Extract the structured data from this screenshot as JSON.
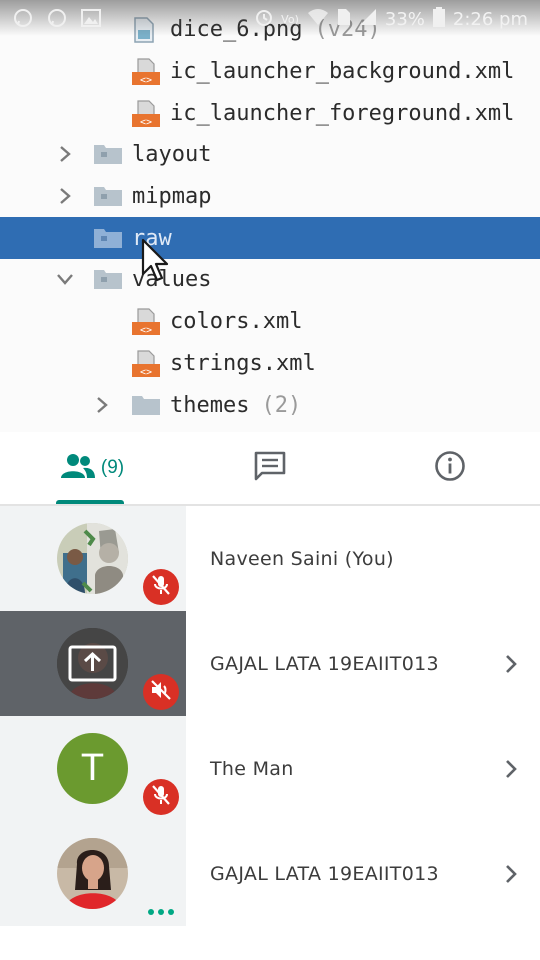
{
  "status_bar": {
    "battery": "33%",
    "time": "2:26 pm",
    "left_icons": [
      "whatsapp-icon",
      "whatsapp-icon",
      "image-icon"
    ],
    "right_icons": [
      "alarm-icon",
      "volte-icon",
      "wifi-icon",
      "sim-icon",
      "signal-icon",
      "battery-icon"
    ]
  },
  "project_tree": {
    "items": [
      {
        "label": "dice_6.png",
        "count": "(v24)",
        "icon": "image-file-icon"
      },
      {
        "label": "ic_launcher_background.xml",
        "icon": "xml-file-icon"
      },
      {
        "label": "ic_launcher_foreground.xml",
        "icon": "xml-file-icon"
      },
      {
        "label": "layout",
        "icon": "folder-icon",
        "chevron": "right"
      },
      {
        "label": "mipmap",
        "icon": "folder-icon",
        "chevron": "right"
      },
      {
        "label": "raw",
        "icon": "folder-icon",
        "selected": true
      },
      {
        "label": "values",
        "icon": "folder-icon",
        "chevron": "down"
      },
      {
        "label": "colors.xml",
        "icon": "xml-file-icon"
      },
      {
        "label": "strings.xml",
        "icon": "xml-file-icon"
      },
      {
        "label": "themes",
        "count": "(2)",
        "icon": "folder-icon",
        "chevron": "right"
      }
    ]
  },
  "tabs": {
    "people_count": "(9)",
    "active": "people",
    "accent_color": "#00897b"
  },
  "participants": [
    {
      "name": "Naveen Saini (You)",
      "avatar": "photo",
      "status": "muted"
    },
    {
      "name": "GAJAL LATA 19EAIIT013",
      "avatar": "presenting",
      "status": "audio-off",
      "chevron": true
    },
    {
      "name": "The Man",
      "avatar": "letter",
      "letter": "T",
      "avatar_color": "#6b9a2f",
      "status": "muted",
      "chevron": true
    },
    {
      "name": "GAJAL LATA 19EAIIT013",
      "avatar": "photo",
      "status": "more",
      "chevron": true
    }
  ]
}
